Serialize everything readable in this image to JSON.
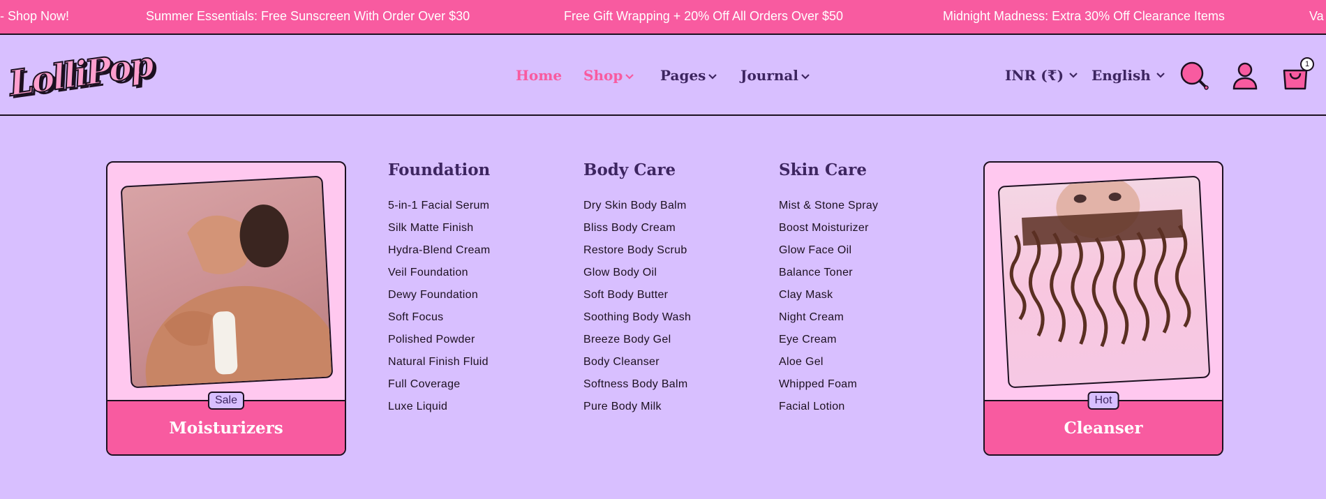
{
  "announcements": [
    "- Shop Now!",
    "Summer Essentials: Free Sunscreen With Order Over $30",
    "Free Gift Wrapping + 20% Off All Orders Over $50",
    "Midnight Madness: Extra 30% Off Clearance Items",
    "Va"
  ],
  "brand": {
    "logo_text": "LolliPop"
  },
  "nav": {
    "home": "Home",
    "shop": "Shop",
    "pages": "Pages",
    "journal": "Journal"
  },
  "utility": {
    "currency": "INR (₹)",
    "language": "English",
    "cart_count": "1"
  },
  "icons": {
    "search": "search-icon",
    "user": "user-icon",
    "cart": "cart-icon",
    "chevron": "chevron-down-icon"
  },
  "colors": {
    "accent_pink": "#f85ba0",
    "background_lavender": "#d8bfff",
    "card_pink": "#ffc8ef",
    "text_purple": "#3d2560"
  },
  "mega_menu": {
    "left_card": {
      "badge": "Sale",
      "title": "Moisturizers"
    },
    "right_card": {
      "badge": "Hot",
      "title": "Cleanser"
    },
    "columns": [
      {
        "heading": "Foundation",
        "items": [
          "5-in-1 Facial Serum",
          "Silk Matte Finish",
          "Hydra-Blend Cream",
          "Veil Foundation",
          "Dewy Foundation",
          "Soft Focus",
          "Polished Powder",
          "Natural Finish Fluid",
          "Full Coverage",
          "Luxe Liquid"
        ]
      },
      {
        "heading": "Body Care",
        "items": [
          "Dry Skin Body Balm",
          "Bliss Body Cream",
          "Restore Body Scrub",
          "Glow Body Oil",
          "Soft Body Butter",
          "Soothing Body Wash",
          "Breeze Body Gel",
          "Body Cleanser",
          "Softness Body Balm",
          "Pure Body Milk"
        ]
      },
      {
        "heading": "Skin Care",
        "items": [
          "Mist & Stone Spray",
          "Boost Moisturizer",
          "Glow Face Oil",
          "Balance Toner",
          "Clay Mask",
          "Night Cream",
          "Eye Cream",
          "Aloe Gel",
          "Whipped Foam",
          "Facial Lotion"
        ]
      }
    ]
  }
}
